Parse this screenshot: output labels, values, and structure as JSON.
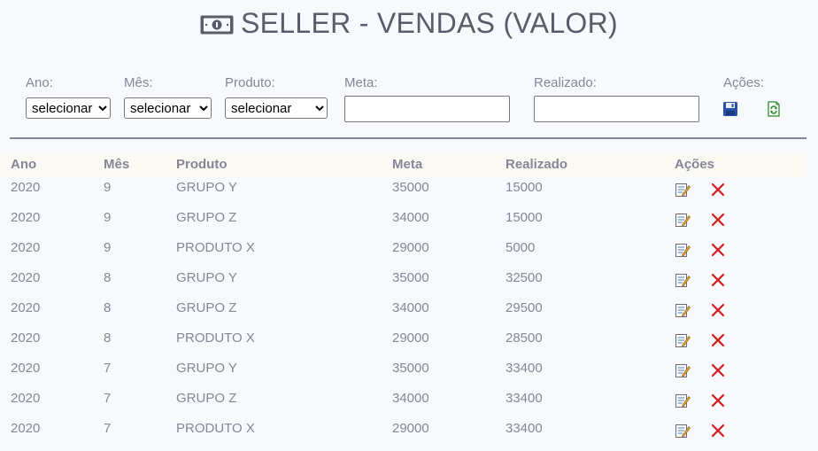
{
  "header": {
    "title": "SELLER - VENDAS (VALOR)",
    "icon": "money-bill-icon"
  },
  "filters": {
    "ano": {
      "label": "Ano:",
      "selected": "selecionar"
    },
    "mes": {
      "label": "Mês:",
      "selected": "selecionar"
    },
    "produto": {
      "label": "Produto:",
      "selected": "selecionar"
    },
    "meta": {
      "label": "Meta:",
      "value": ""
    },
    "realizado": {
      "label": "Realizado:",
      "value": ""
    },
    "acoes": {
      "label": "Ações:",
      "icons": [
        "save-icon",
        "refresh-icon"
      ]
    }
  },
  "table": {
    "headers": [
      "Ano",
      "Mês",
      "Produto",
      "Meta",
      "Realizado",
      "Ações"
    ],
    "row_icons": [
      "edit-icon",
      "delete-icon"
    ],
    "rows": [
      [
        "2020",
        "9",
        "GRUPO Y",
        "35000",
        "15000"
      ],
      [
        "2020",
        "9",
        "GRUPO Z",
        "34000",
        "15000"
      ],
      [
        "2020",
        "9",
        "PRODUTO X",
        "29000",
        "5000"
      ],
      [
        "2020",
        "8",
        "GRUPO Y",
        "35000",
        "32500"
      ],
      [
        "2020",
        "8",
        "GRUPO Z",
        "34000",
        "29500"
      ],
      [
        "2020",
        "8",
        "PRODUTO X",
        "29000",
        "28500"
      ],
      [
        "2020",
        "7",
        "GRUPO Y",
        "35000",
        "33400"
      ],
      [
        "2020",
        "7",
        "GRUPO Z",
        "34000",
        "33400"
      ],
      [
        "2020",
        "7",
        "PRODUTO X",
        "29000",
        "33400"
      ]
    ]
  },
  "colors": {
    "background": "#f8f9fc",
    "title": "#5a5c69",
    "text": "#858796",
    "delete": "#d01c1c",
    "save": "#2a4fa8",
    "refresh": "#2e8b2e"
  }
}
